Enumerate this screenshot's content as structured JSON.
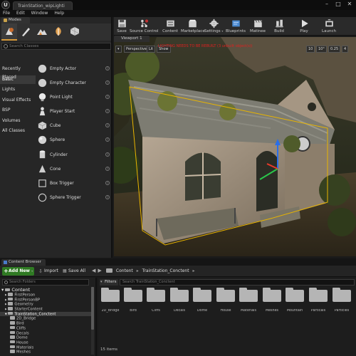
{
  "window": {
    "tab_title": "TrainStation_wipLighti",
    "controls": [
      "–",
      "□",
      "✕"
    ]
  },
  "menu": [
    "File",
    "Edit",
    "Window",
    "Help"
  ],
  "modes": {
    "tab_label": "Modes",
    "search_placeholder": "Search Classes",
    "categories": [
      "Recently Placed",
      "Basic",
      "Lights",
      "Visual Effects",
      "BSP",
      "Volumes",
      "All Classes"
    ],
    "items": [
      "Empty Actor",
      "Empty Character",
      "Point Light",
      "Player Start",
      "Cube",
      "Sphere",
      "Cylinder",
      "Cone",
      "Box Trigger",
      "Sphere Trigger"
    ]
  },
  "toolbar": {
    "buttons": [
      "Save",
      "Source Control",
      "Content",
      "Marketplace",
      "Settings",
      "Blueprints",
      "Matinee",
      "Build",
      "Play",
      "Launch"
    ]
  },
  "viewport": {
    "tab_label": "Viewport 1",
    "chips": [
      "▾",
      "Perspective",
      "Lit",
      "Show",
      "10",
      "10°",
      "0.25",
      "4"
    ],
    "warning": "LIGHTING NEEDS TO BE REBUILT (3 unbuilt object(s))"
  },
  "content_browser": {
    "tab_label": "Content Browser",
    "add_new": "Add New",
    "import": "Import",
    "save_all": "Save All",
    "breadcrumb": [
      "Content",
      "TrainStation_Conctent"
    ],
    "tree_search_placeholder": "Search Folders",
    "filters": "Filters",
    "asset_search_placeholder": "Search TrainStation_Conctent",
    "tree": [
      {
        "label": "Content",
        "root": true
      },
      {
        "label": "FirstPerson"
      },
      {
        "label": "FirstPersonBP"
      },
      {
        "label": "Geometry"
      },
      {
        "label": "StarterContent"
      },
      {
        "label": "TrainStation_Conctent",
        "selected": true
      },
      {
        "label": "2D_Bridge"
      },
      {
        "label": "Bird"
      },
      {
        "label": "Cliffs"
      },
      {
        "label": "Decals"
      },
      {
        "label": "Dome"
      },
      {
        "label": "House"
      },
      {
        "label": "Materials"
      },
      {
        "label": "Meshes"
      }
    ],
    "assets": [
      "2D_Bridge",
      "Bird",
      "Cliffs",
      "Decals",
      "Dome",
      "House",
      "Materials",
      "Meshes",
      "Mountain",
      "Particals",
      "Particles"
    ],
    "item_count": "15 items"
  },
  "colors": {
    "accent_orange": "#d79a3a",
    "add_new_green": "#2f7a23",
    "warning_red": "#e02020",
    "selection_yellow": "#e8b400"
  }
}
